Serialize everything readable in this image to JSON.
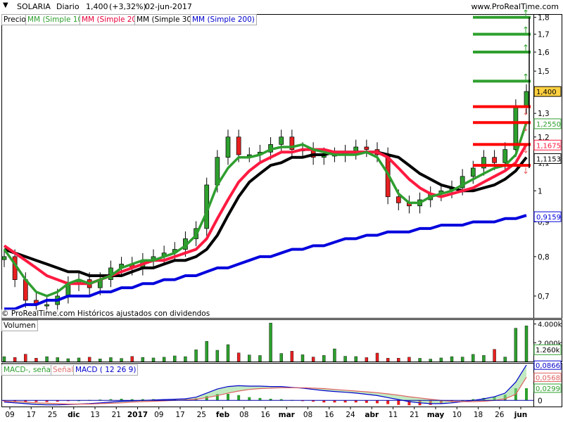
{
  "header": {
    "ticker": "SOLARIA",
    "period": "Diario",
    "price": "1,400",
    "change": "(+3,32%)",
    "date": "02-jun-2017",
    "brand": "www.ProRealTime.com"
  },
  "price_pane": {
    "legend": {
      "precio": "Precio",
      "ma10": "MM (Simple 10)",
      "ma20": "MM (Simple 20)",
      "ma30": "MM (Simple 30)",
      "ma200": "MM (Simple 200)"
    },
    "footer_note": "© ProRealTime.com Históricos ajustados con dividendos"
  },
  "volume_pane": {
    "legend": "Volumen"
  },
  "macd_pane": {
    "legend_macd": "MACD-, señal",
    "legend_signal": "Señal",
    "legend_macd2": "MACD ( 12 26 9)"
  },
  "colors": {
    "ma10": "#2e9e2e",
    "ma20": "#ff1a40",
    "ma30": "#000000",
    "ma200": "#0000dd",
    "up": "#2ea02e",
    "down": "#e82020",
    "price_tag": "#ffd040"
  },
  "chart_data": [
    {
      "type": "line",
      "pane": "price",
      "y_scale": "log",
      "ylim": [
        0.65,
        1.82
      ],
      "y_ticks": [
        "0,7",
        "0,8",
        "0,9",
        "1",
        "1,1",
        "1,2",
        "1,3",
        "1,5",
        "1,6",
        "1,7",
        "1,8"
      ],
      "x_ticks": [
        "09",
        "17",
        "25",
        "dic",
        "13",
        "21",
        "2017",
        "09",
        "17",
        "25",
        "feb",
        "08",
        "16",
        "mar",
        "08",
        "16",
        "24",
        "abr",
        "11",
        "21",
        "may",
        "10",
        "18",
        "26",
        "jun"
      ],
      "last_values": {
        "price": "1,400",
        "ma10": "1,2550",
        "ma20": "1,1675",
        "ma30": "1,1153",
        "ma200": "0,9159"
      },
      "resistance_levels_green": [
        1.8,
        1.7,
        1.6,
        1.45
      ],
      "resistance_levels_red": [
        1.33,
        1.26,
        1.17,
        1.09
      ],
      "series": [
        {
          "name": "MM (Simple 10)",
          "values": [
            0.82,
            0.78,
            0.74,
            0.71,
            0.7,
            0.71,
            0.73,
            0.74,
            0.73,
            0.74,
            0.75,
            0.77,
            0.78,
            0.79,
            0.79,
            0.8,
            0.81,
            0.83,
            0.86,
            0.93,
            1.02,
            1.08,
            1.12,
            1.12,
            1.13,
            1.15,
            1.16,
            1.16,
            1.17,
            1.15,
            1.14,
            1.13,
            1.13,
            1.13,
            1.14,
            1.12,
            1.06,
            0.99,
            0.96,
            0.96,
            0.98,
            0.99,
            1.0,
            1.02,
            1.04,
            1.06,
            1.08,
            1.09,
            1.13,
            1.26
          ]
        },
        {
          "name": "MM (Simple 20)",
          "values": [
            0.83,
            0.81,
            0.79,
            0.77,
            0.75,
            0.74,
            0.73,
            0.73,
            0.73,
            0.74,
            0.75,
            0.76,
            0.77,
            0.78,
            0.79,
            0.79,
            0.8,
            0.81,
            0.82,
            0.85,
            0.91,
            0.97,
            1.03,
            1.07,
            1.1,
            1.12,
            1.14,
            1.14,
            1.15,
            1.15,
            1.15,
            1.14,
            1.14,
            1.14,
            1.14,
            1.14,
            1.12,
            1.08,
            1.04,
            1.01,
            0.99,
            0.98,
            0.99,
            1.0,
            1.01,
            1.03,
            1.05,
            1.07,
            1.1,
            1.17
          ]
        },
        {
          "name": "MM (Simple 30)",
          "values": [
            0.82,
            0.81,
            0.8,
            0.79,
            0.78,
            0.77,
            0.76,
            0.76,
            0.75,
            0.75,
            0.75,
            0.75,
            0.76,
            0.77,
            0.77,
            0.78,
            0.79,
            0.79,
            0.8,
            0.82,
            0.86,
            0.92,
            0.98,
            1.03,
            1.06,
            1.09,
            1.1,
            1.12,
            1.12,
            1.13,
            1.13,
            1.14,
            1.14,
            1.14,
            1.14,
            1.14,
            1.13,
            1.12,
            1.09,
            1.06,
            1.04,
            1.02,
            1.01,
            1.0,
            1.0,
            1.01,
            1.02,
            1.04,
            1.07,
            1.12
          ]
        },
        {
          "name": "MM (Simple 200)",
          "values": [
            0.67,
            0.67,
            0.68,
            0.68,
            0.69,
            0.69,
            0.7,
            0.7,
            0.7,
            0.71,
            0.71,
            0.72,
            0.72,
            0.73,
            0.73,
            0.74,
            0.74,
            0.75,
            0.75,
            0.76,
            0.77,
            0.77,
            0.78,
            0.79,
            0.8,
            0.8,
            0.81,
            0.82,
            0.82,
            0.83,
            0.83,
            0.84,
            0.85,
            0.85,
            0.86,
            0.86,
            0.87,
            0.87,
            0.87,
            0.88,
            0.88,
            0.89,
            0.89,
            0.89,
            0.9,
            0.9,
            0.9,
            0.91,
            0.91,
            0.92
          ]
        },
        {
          "name": "Precio",
          "values": [
            0.8,
            0.74,
            0.69,
            0.68,
            0.68,
            0.7,
            0.73,
            0.74,
            0.72,
            0.74,
            0.77,
            0.78,
            0.77,
            0.79,
            0.8,
            0.81,
            0.82,
            0.85,
            0.88,
            1.02,
            1.12,
            1.2,
            1.13,
            1.13,
            1.14,
            1.17,
            1.2,
            1.15,
            1.15,
            1.12,
            1.13,
            1.13,
            1.14,
            1.16,
            1.15,
            1.13,
            0.98,
            0.96,
            0.95,
            0.97,
            0.99,
            1.0,
            1.01,
            1.05,
            1.08,
            1.12,
            1.1,
            1.15,
            1.33,
            1.4
          ]
        }
      ]
    },
    {
      "type": "bar",
      "pane": "volume",
      "y_ticks": [
        "4.000k",
        "2.000k"
      ],
      "last_value": "1.260k",
      "values": [
        520,
        430,
        780,
        360,
        520,
        420,
        300,
        380,
        460,
        280,
        420,
        330,
        540,
        440,
        380,
        460,
        600,
        520,
        1250,
        2150,
        1200,
        1800,
        920,
        700,
        640,
        4100,
        860,
        1100,
        720,
        480,
        650,
        1350,
        560,
        530,
        420,
        900,
        360,
        360,
        460,
        340,
        260,
        380,
        520,
        480,
        760,
        650,
        1300,
        480,
        3550,
        3800
      ]
    },
    {
      "type": "area",
      "pane": "macd",
      "ylim": [
        -0.015,
        0.092
      ],
      "y_ticks": [
        "0"
      ],
      "last_values": {
        "macd": "0,0866",
        "signal": "0,0568",
        "histogram": "0,0299"
      },
      "series": [
        {
          "name": "MACD",
          "values": [
            -0.004,
            -0.006,
            -0.008,
            -0.01,
            -0.011,
            -0.011,
            -0.01,
            -0.009,
            -0.008,
            -0.006,
            -0.004,
            -0.002,
            -0.001,
            0.0,
            0.001,
            0.002,
            0.003,
            0.004,
            0.008,
            0.018,
            0.028,
            0.034,
            0.036,
            0.035,
            0.035,
            0.034,
            0.034,
            0.032,
            0.03,
            0.027,
            0.024,
            0.022,
            0.02,
            0.018,
            0.015,
            0.012,
            0.007,
            0.002,
            -0.003,
            -0.006,
            -0.008,
            -0.008,
            -0.006,
            -0.003,
            0.0,
            0.004,
            0.009,
            0.018,
            0.045,
            0.087
          ]
        },
        {
          "name": "Señal",
          "values": [
            -0.002,
            -0.003,
            -0.004,
            -0.006,
            -0.007,
            -0.008,
            -0.009,
            -0.009,
            -0.009,
            -0.008,
            -0.007,
            -0.006,
            -0.004,
            -0.003,
            -0.002,
            -0.001,
            0.0,
            0.001,
            0.003,
            0.007,
            0.012,
            0.018,
            0.023,
            0.027,
            0.029,
            0.03,
            0.031,
            0.031,
            0.031,
            0.03,
            0.029,
            0.027,
            0.025,
            0.023,
            0.021,
            0.019,
            0.016,
            0.013,
            0.009,
            0.006,
            0.003,
            0.0,
            -0.002,
            -0.003,
            -0.003,
            -0.002,
            0.0,
            0.004,
            0.015,
            0.057
          ]
        }
      ]
    }
  ]
}
